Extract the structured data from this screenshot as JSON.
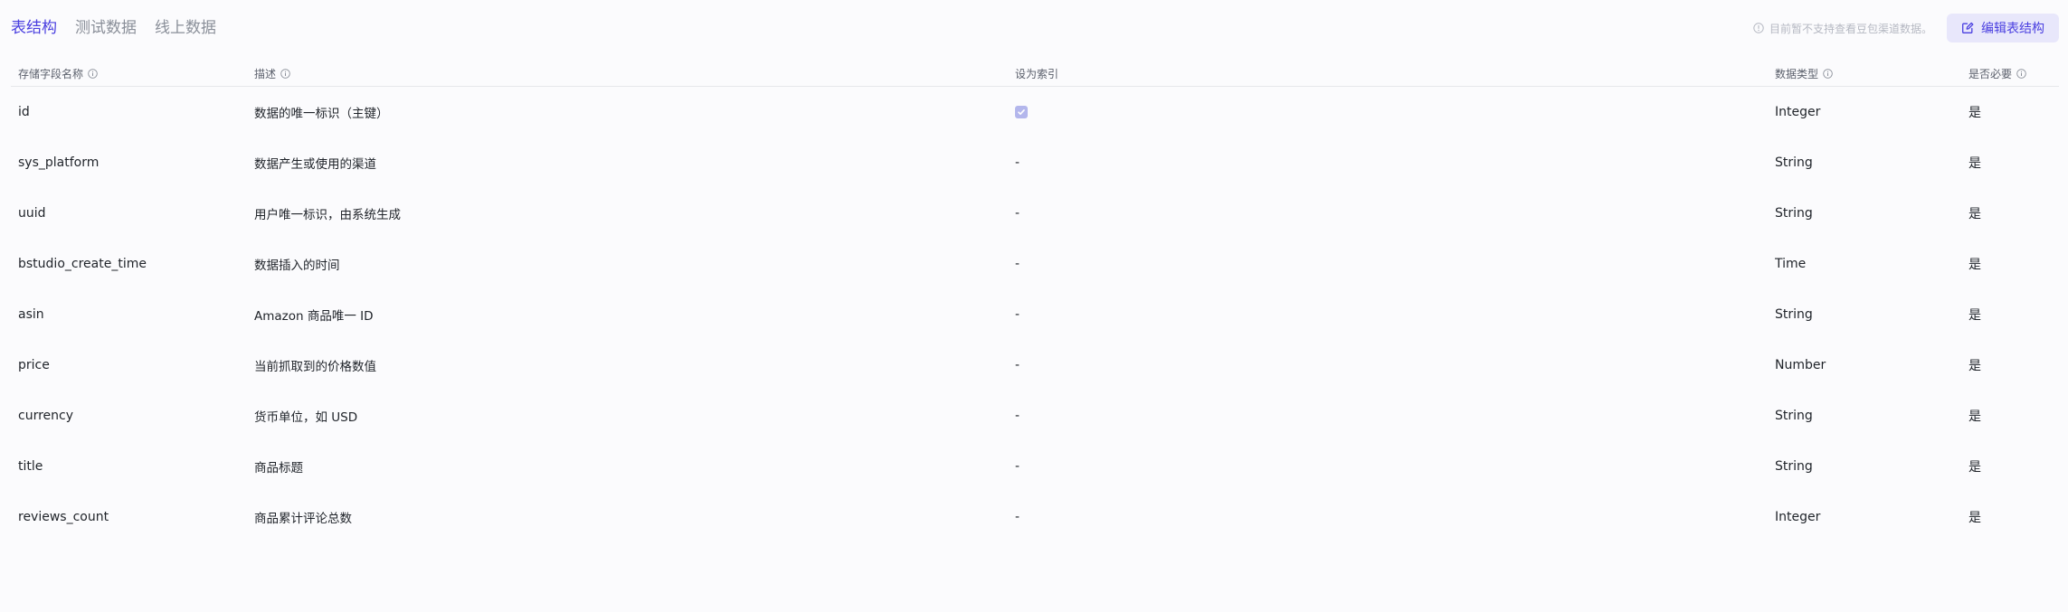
{
  "tabs": [
    {
      "label": "表结构",
      "active": true
    },
    {
      "label": "测试数据",
      "active": false
    },
    {
      "label": "线上数据",
      "active": false
    }
  ],
  "notice": {
    "text": "目前暂不支持查看豆包渠道数据。",
    "icon": "info-circle-icon"
  },
  "edit_button": {
    "label": "编辑表结构",
    "icon": "edit-icon"
  },
  "table": {
    "headers": {
      "field": "存储字段名称",
      "desc": "描述",
      "index": "设为索引",
      "type": "数据类型",
      "required": "是否必要"
    },
    "rows": [
      {
        "field": "id",
        "desc": "数据的唯一标识（主键）",
        "index": "",
        "index_checked": true,
        "type": "Integer",
        "required": "是"
      },
      {
        "field": "sys_platform",
        "desc": "数据产生或使用的渠道",
        "index": "-",
        "index_checked": false,
        "type": "String",
        "required": "是"
      },
      {
        "field": "uuid",
        "desc": "用户唯一标识，由系统生成",
        "index": "-",
        "index_checked": false,
        "type": "String",
        "required": "是"
      },
      {
        "field": "bstudio_create_time",
        "desc": "数据插入的时间",
        "index": "-",
        "index_checked": false,
        "type": "Time",
        "required": "是"
      },
      {
        "field": "asin",
        "desc": "Amazon 商品唯一 ID",
        "index": "-",
        "index_checked": false,
        "type": "String",
        "required": "是"
      },
      {
        "field": "price",
        "desc": "当前抓取到的价格数值",
        "index": "-",
        "index_checked": false,
        "type": "Number",
        "required": "是"
      },
      {
        "field": "currency",
        "desc": "货币单位，如 USD",
        "index": "-",
        "index_checked": false,
        "type": "String",
        "required": "是"
      },
      {
        "field": "title",
        "desc": "商品标题",
        "index": "-",
        "index_checked": false,
        "type": "String",
        "required": "是"
      },
      {
        "field": "reviews_count",
        "desc": "商品累计评论总数",
        "index": "-",
        "index_checked": false,
        "type": "Integer",
        "required": "是"
      }
    ]
  },
  "colors": {
    "accent": "#4a3fe0",
    "button_bg": "#e8e7fb",
    "checkbox": "#b3b6ec",
    "background": "#fbfbfd"
  }
}
